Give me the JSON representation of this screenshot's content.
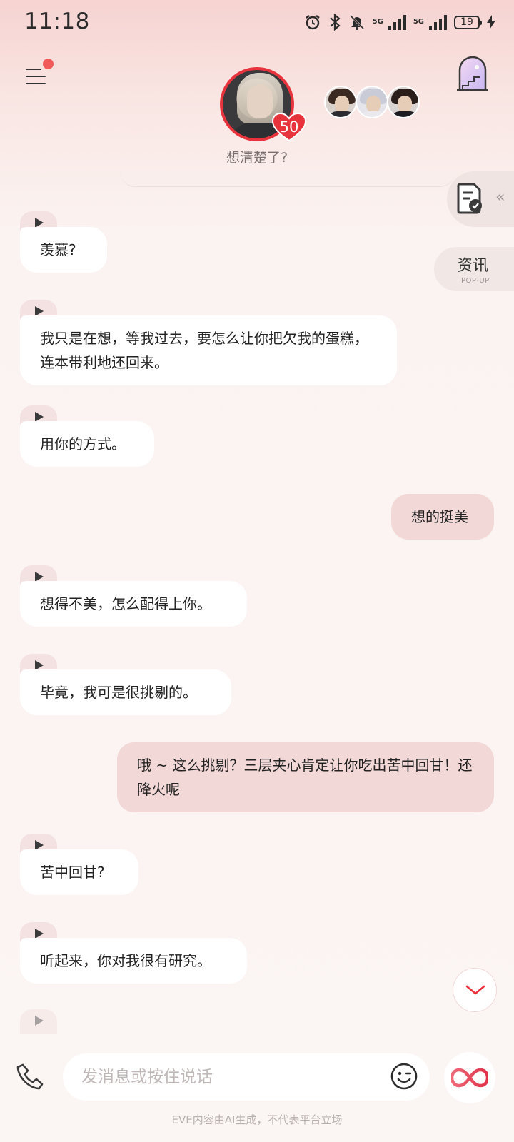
{
  "status_bar": {
    "time": "11:18",
    "net1": "5G",
    "net2": "5G",
    "battery": "19"
  },
  "header": {
    "subtitle": "想清楚了?",
    "affinity": "50"
  },
  "side": {
    "news_title": "资讯",
    "news_sub": "POP-UP"
  },
  "messages": [
    {
      "from": "character",
      "text": "羡慕?"
    },
    {
      "from": "character",
      "text": "我只是在想，等我过去，要怎么让你把欠我的蛋糕，连本带利地还回来。"
    },
    {
      "from": "character",
      "text": "用你的方式。"
    },
    {
      "from": "user",
      "text": "想的挺美"
    },
    {
      "from": "character",
      "text": "想得不美，怎么配得上你。"
    },
    {
      "from": "character",
      "text": "毕竟，我可是很挑剔的。"
    },
    {
      "from": "user",
      "text": "哦 ~ 这么挑剔？三层夹心肯定让你吃出苦中回甘！还降火呢"
    },
    {
      "from": "character",
      "text": "苦中回甘?"
    },
    {
      "from": "character",
      "text": "听起来，你对我很有研究。"
    }
  ],
  "input": {
    "placeholder": "发消息或按住说话"
  },
  "footer": {
    "note": "EVE内容由AI生成，不代表平台立场"
  },
  "colors": {
    "accent": "#e8333c",
    "user_bubble": "#f2d8d7",
    "menu_dot": "#f25a5a"
  },
  "icons": [
    "menu-icon",
    "door-stairs-icon",
    "document-check-icon",
    "play-icon",
    "chevron-down-icon",
    "phone-icon",
    "emoji-icon",
    "infinity-icon",
    "heart-icon"
  ]
}
